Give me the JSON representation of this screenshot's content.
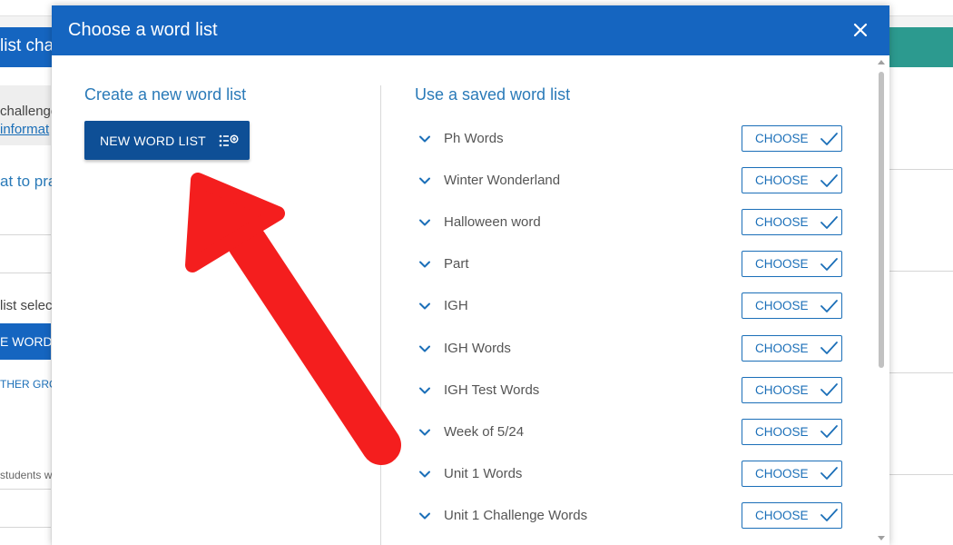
{
  "background": {
    "header_title": "list cha",
    "text_1": "challenge",
    "text_2": "informat",
    "text_3": "at to pra",
    "text_4": "list select",
    "button": "E WORD",
    "link": "THER GRO",
    "text_5": "students w"
  },
  "modal": {
    "title": "Choose a word list",
    "close_icon": "close-icon",
    "create_section_title": "Create a new word list",
    "new_word_list_label": "NEW WORD LIST",
    "saved_section_title": "Use a saved word list",
    "choose_label": "CHOOSE",
    "saved_lists": [
      {
        "name": "Ph Words"
      },
      {
        "name": "Winter Wonderland"
      },
      {
        "name": "Halloween word"
      },
      {
        "name": "Part"
      },
      {
        "name": "IGH"
      },
      {
        "name": "IGH Words"
      },
      {
        "name": "IGH Test Words"
      },
      {
        "name": "Week of 5/24"
      },
      {
        "name": "Unit 1 Words"
      },
      {
        "name": "Unit 1 Challenge Words"
      }
    ]
  },
  "colors": {
    "header_blue": "#1565c0",
    "button_blue": "#0e4f96",
    "accent_blue": "#2a7ab8",
    "arrow_red": "#f41e1e"
  }
}
